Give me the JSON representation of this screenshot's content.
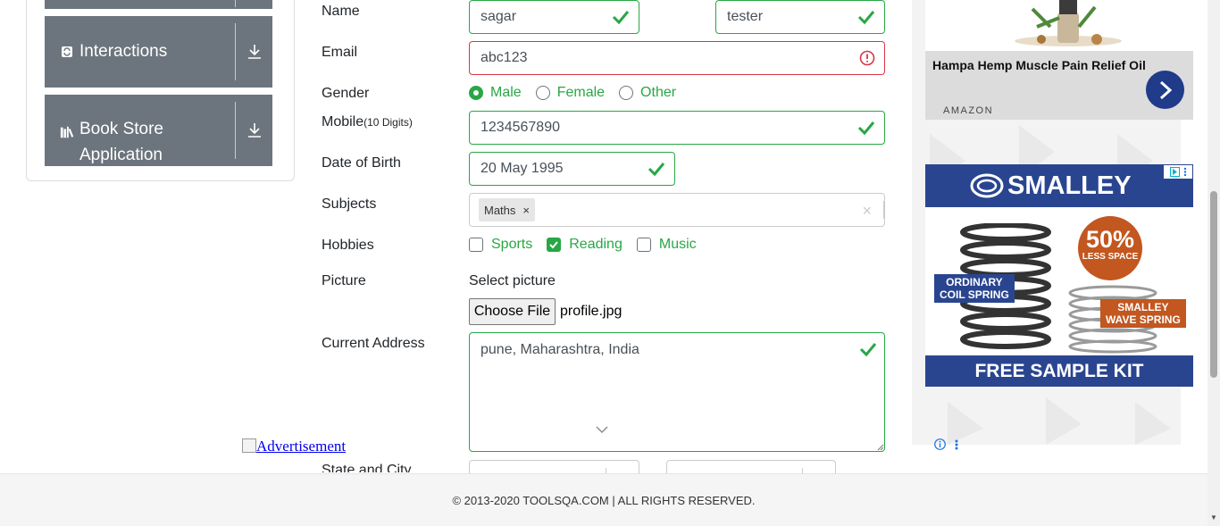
{
  "sidebar": {
    "items": [
      {
        "label": "Interactions",
        "icon": "interactions-icon"
      },
      {
        "label": "Book Store Application",
        "label_line1": "Book Store",
        "label_line2": "Application",
        "icon": "bookstore-icon"
      }
    ]
  },
  "form": {
    "name_label": "Name",
    "first_name": "sagar",
    "last_name": "tester",
    "email_label": "Email",
    "email": "abc123",
    "gender_label": "Gender",
    "gender_options": [
      "Male",
      "Female",
      "Other"
    ],
    "gender_selected": "Male",
    "mobile_label": "Mobile",
    "mobile_hint": "(10 Digits)",
    "mobile": "1234567890",
    "dob_label": "Date of Birth",
    "dob": "20 May 1995",
    "subjects_label": "Subjects",
    "subjects": [
      "Maths"
    ],
    "subject_remove": "×",
    "subjects_clear": "×",
    "hobbies_label": "Hobbies",
    "hobbies": [
      "Sports",
      "Reading",
      "Music"
    ],
    "hobbies_checked": [
      "Reading"
    ],
    "picture_label": "Picture",
    "select_picture": "Select picture",
    "choose_file": "Choose File",
    "file_name": "profile.jpg",
    "address_label": "Current Address",
    "address": "pune, Maharashtra, India",
    "state_city_label": "State and City"
  },
  "ad_link": "Advertisement",
  "footer": "© 2013-2020 TOOLSQA.COM | ALL RIGHTS RESERVED.",
  "ads": {
    "ad1_title": "Hampa Hemp Muscle Pain Relief Oil",
    "ad1_brand": "AMAZON",
    "ad2_brand": "SMALLEY",
    "ad2_percent": "50%",
    "ad2_less": "LESS SPACE",
    "ad2_ordinary_1": "ORDINARY",
    "ad2_ordinary_2": "COIL SPRING",
    "ad2_smalley_1": "SMALLEY",
    "ad2_smalley_2": "WAVE SPRING",
    "ad2_cta": "FREE SAMPLE KIT"
  },
  "colors": {
    "valid": "#28a745",
    "invalid": "#dc3545",
    "sidebar": "#6c757d",
    "ad_blue": "#2a4590",
    "ad_orange": "#c2571f"
  }
}
